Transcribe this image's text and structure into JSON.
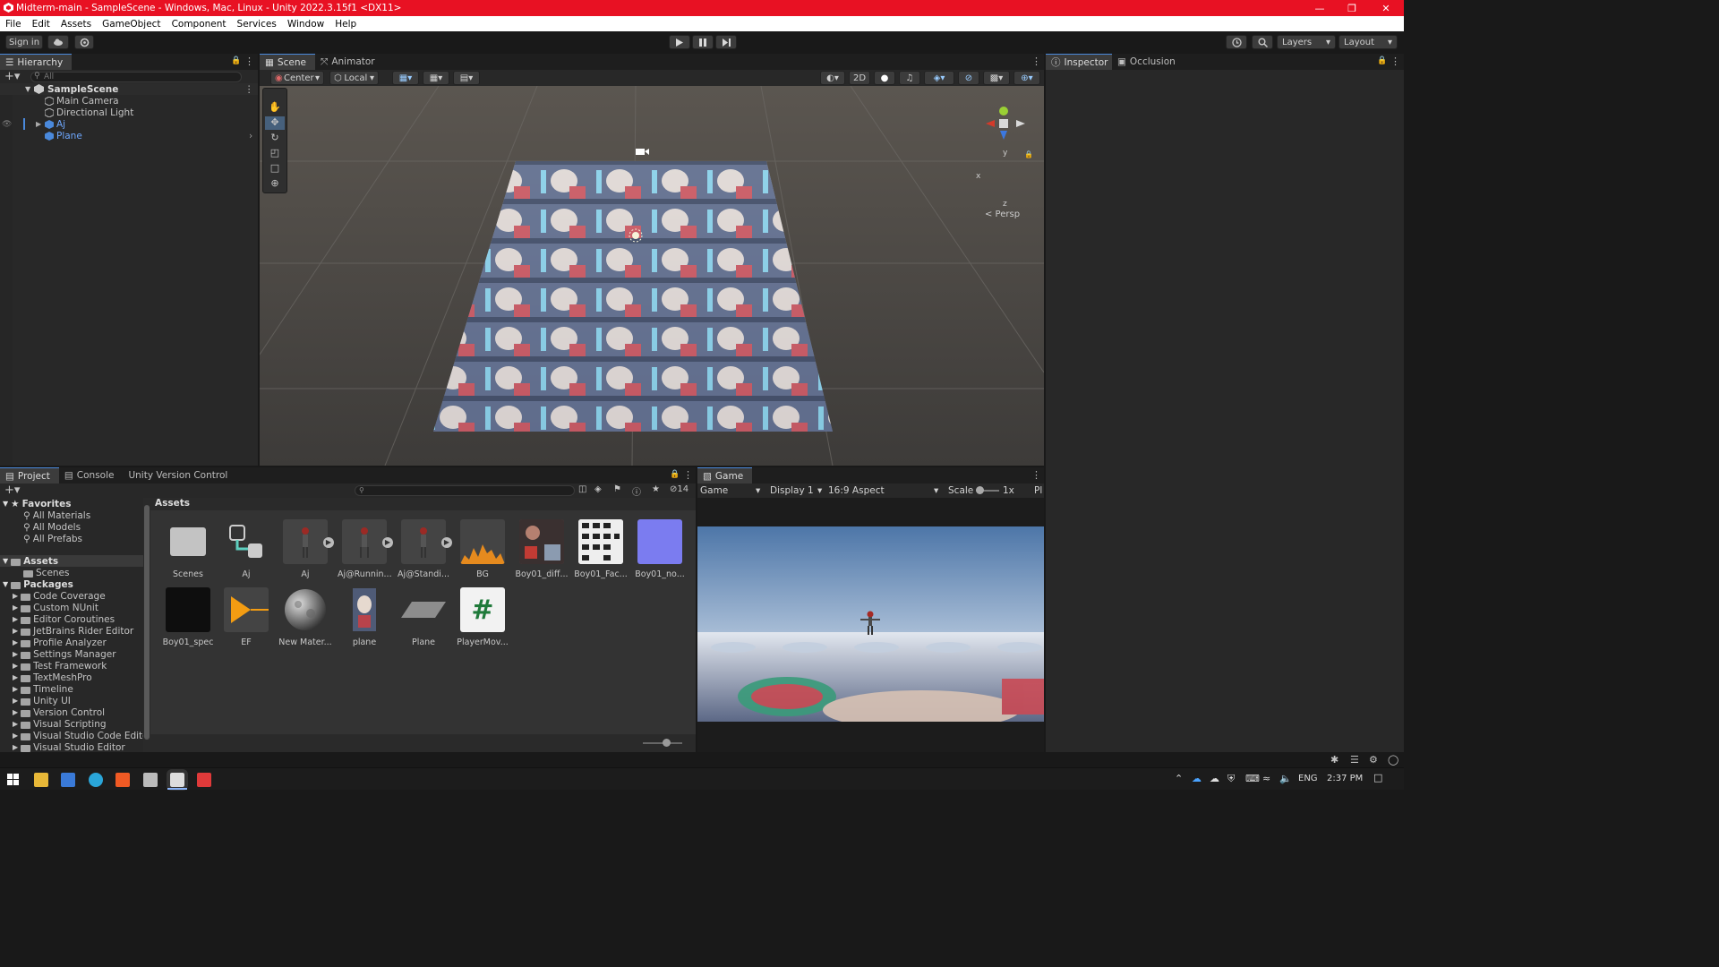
{
  "window": {
    "title": "Midterm-main - SampleScene - Windows, Mac, Linux - Unity 2022.3.15f1 <DX11>"
  },
  "menu": [
    "File",
    "Edit",
    "Assets",
    "GameObject",
    "Component",
    "Services",
    "Window",
    "Help"
  ],
  "toolbar": {
    "sign_in": "Sign in",
    "layers": "Layers",
    "layout": "Layout"
  },
  "hierarchy": {
    "tab": "Hierarchy",
    "search_placeholder": "All",
    "scene": "SampleScene",
    "items": [
      "Main Camera",
      "Directional Light",
      "Aj",
      "Plane"
    ]
  },
  "scene_view": {
    "tabs": [
      "Scene",
      "Animator"
    ],
    "pivot": "Center",
    "space": "Local",
    "mode_2d": "2D",
    "gizmo_labels": {
      "y": "y",
      "x": "x",
      "z": "z",
      "persp": "< Persp"
    }
  },
  "inspector": {
    "tabs": [
      "Inspector",
      "Occlusion"
    ]
  },
  "project": {
    "tabs": [
      "Project",
      "Console",
      "Unity Version Control"
    ],
    "hidden_count": "14",
    "favorites": {
      "label": "Favorites",
      "items": [
        "All Materials",
        "All Models",
        "All Prefabs"
      ]
    },
    "assets_root": {
      "label": "Assets",
      "items": [
        "Scenes"
      ]
    },
    "packages": {
      "label": "Packages",
      "items": [
        "Code Coverage",
        "Custom NUnit",
        "Editor Coroutines",
        "JetBrains Rider Editor",
        "Profile Analyzer",
        "Settings Manager",
        "Test Framework",
        "TextMeshPro",
        "Timeline",
        "Unity UI",
        "Version Control",
        "Visual Scripting",
        "Visual Studio Code Editor",
        "Visual Studio Editor"
      ]
    },
    "breadcrumb": "Assets",
    "assets": [
      {
        "name": "Scenes",
        "kind": "folder"
      },
      {
        "name": "Aj",
        "kind": "prefab-variant"
      },
      {
        "name": "Aj",
        "kind": "model"
      },
      {
        "name": "Aj@Runnin...",
        "kind": "model"
      },
      {
        "name": "Aj@Standi...",
        "kind": "model"
      },
      {
        "name": "BG",
        "kind": "audio"
      },
      {
        "name": "Boy01_diff...",
        "kind": "texture"
      },
      {
        "name": "Boy01_Fac...",
        "kind": "texture"
      },
      {
        "name": "Boy01_no...",
        "kind": "normal-map"
      },
      {
        "name": "Boy01_spec",
        "kind": "texture-dark"
      },
      {
        "name": "EF",
        "kind": "audio-clip"
      },
      {
        "name": "New Mater...",
        "kind": "material"
      },
      {
        "name": "plane",
        "kind": "image"
      },
      {
        "name": "Plane",
        "kind": "prefab"
      },
      {
        "name": "PlayerMov...",
        "kind": "script"
      }
    ]
  },
  "game_view": {
    "tab": "Game",
    "mode": "Game",
    "display": "Display 1",
    "aspect": "16:9 Aspect",
    "scale_label": "Scale",
    "scale_value": "1x",
    "play_mode": "Pl"
  },
  "taskbar": {
    "language": "ENG",
    "time": "2:37 PM"
  },
  "colors": {
    "titlebar": "#e81123",
    "panel": "#282828",
    "accent": "#4a89dc",
    "link_blue": "#6ea8ff"
  }
}
